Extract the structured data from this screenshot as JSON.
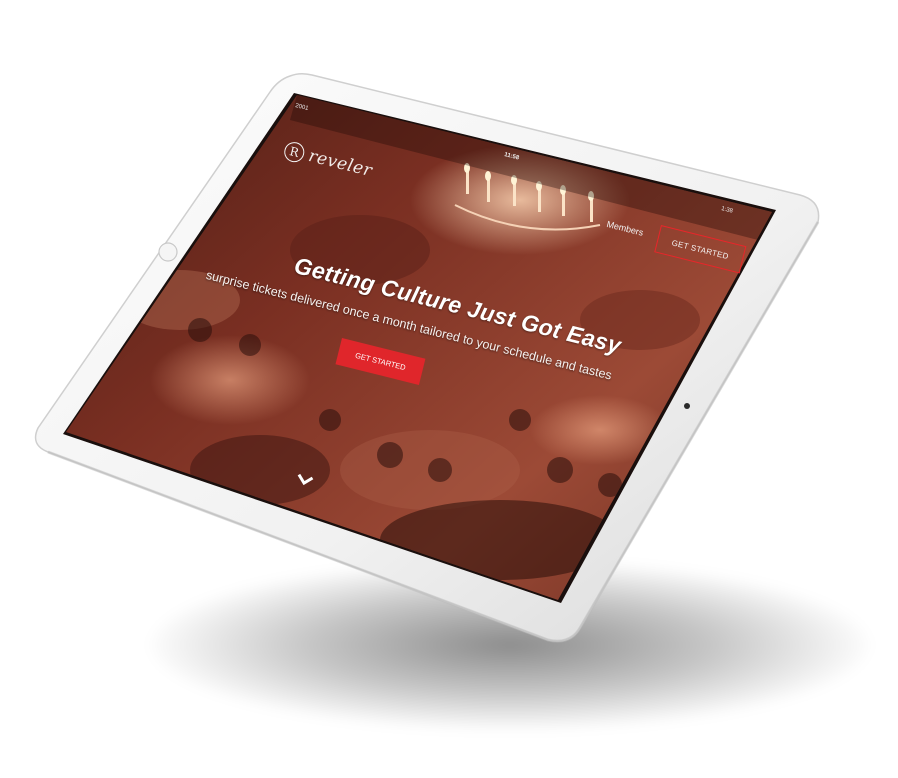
{
  "status_bar": {
    "left_text": "2001",
    "time": "11:58",
    "right_text": "1:38"
  },
  "brand": {
    "logo_letter": "R",
    "name": "reveler"
  },
  "nav": {
    "members_label": "Members",
    "get_started_label": "GET STARTED"
  },
  "hero": {
    "headline": "Getting Culture Just Got Easy",
    "subheadline": "surprise tickets delivered once a month tailored to your schedule and tastes",
    "cta_label": "GET STARTED"
  },
  "icons": {
    "scroll": "chevron-down-icon",
    "logo": "logo-circle-icon"
  },
  "colors": {
    "accent": "#e0262b",
    "overlay_tint": "#7a2a1e",
    "bezel": "#f2f2f2"
  }
}
